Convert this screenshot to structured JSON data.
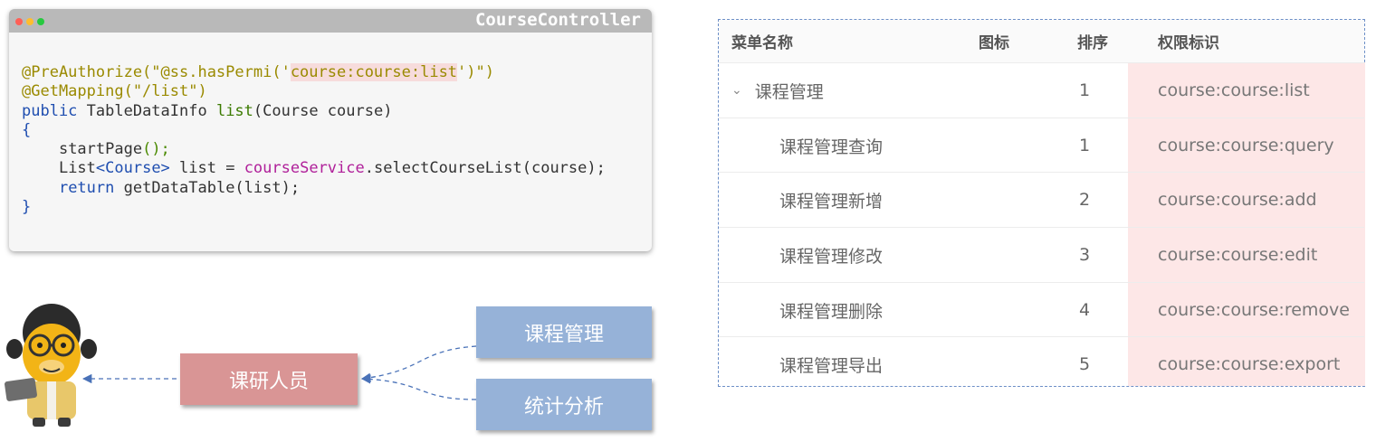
{
  "code_window": {
    "title": "CourseController",
    "lines": {
      "l1_ann": "@PreAuthorize(\"@ss.hasPermi('",
      "l1_perm": "course:course:list",
      "l1_end": "')\")",
      "l2": "@GetMapping(\"/list\")",
      "l3_kw": "public",
      "l3_type": " TableDataInfo ",
      "l3_fn": "list",
      "l3_params": "(Course course)",
      "l4": "{",
      "l5": "startPage",
      "l5_end": "();",
      "l6_a": "List",
      "l6_b": "<Course>",
      "l6_c": " list = ",
      "l6_svc": "courseService",
      "l6_d": ".selectCourseList(course);",
      "l7_kw": "return",
      "l7_rest": " getDataTable(list);",
      "l8": "}"
    }
  },
  "diagram": {
    "role_label": "课研人员",
    "menus": [
      "课程管理",
      "统计分析"
    ],
    "colors": {
      "role": "#d99595",
      "menu": "#96b2d8",
      "arrow": "#4a72b8"
    },
    "icons": [
      "monkey-mascot-icon"
    ]
  },
  "permission_table": {
    "headers": {
      "name": "菜单名称",
      "icon": "图标",
      "order": "排序",
      "perm": "权限标识"
    },
    "rows": [
      {
        "name": "课程管理",
        "order": "1",
        "perm": "course:course:list",
        "expanded": true
      },
      {
        "name": "课程管理查询",
        "order": "1",
        "perm": "course:course:query"
      },
      {
        "name": "课程管理新增",
        "order": "2",
        "perm": "course:course:add"
      },
      {
        "name": "课程管理修改",
        "order": "3",
        "perm": "course:course:edit"
      },
      {
        "name": "课程管理删除",
        "order": "4",
        "perm": "course:course:remove"
      },
      {
        "name": "课程管理导出",
        "order": "5",
        "perm": "course:course:export"
      }
    ],
    "highlight_color": "#fde7e7"
  }
}
